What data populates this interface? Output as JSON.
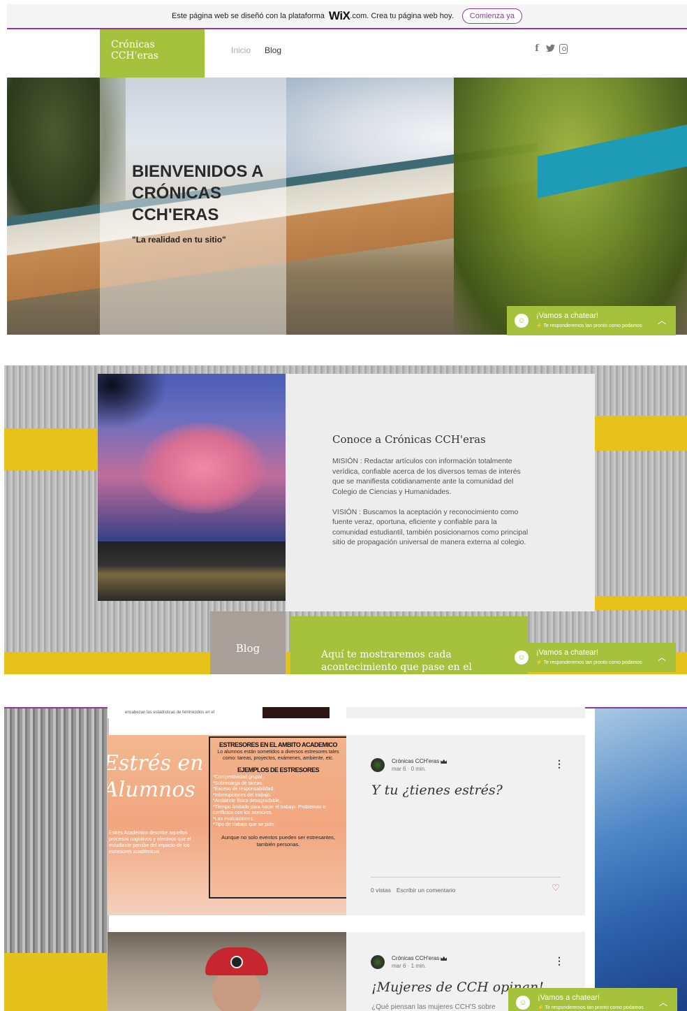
{
  "wix_banner": {
    "text_prefix": "Este página web se diseñó con la plataforma",
    "brand": "WiX",
    "text_suffix": ".com. Crea tu página web hoy.",
    "cta_label": "Comienza ya"
  },
  "header": {
    "logo": "Crónicas CCH'eras",
    "nav": [
      "Inicio",
      "Blog"
    ],
    "social_icons": [
      "facebook-icon",
      "twitter-icon",
      "instagram-icon"
    ]
  },
  "hero": {
    "title": "BIENVENIDOS A CRÓNICAS CCH'ERAS",
    "subtitle": "\"La realidad en tu sitio\""
  },
  "chat": {
    "title": "¡Vamos a chatear!",
    "subtitle": "Te responderemos tan pronto como podamos"
  },
  "about": {
    "title": "Conoce a Crónicas CCH'eras",
    "mission": "MISIÓN : Redactar artículos con información totalmente verídica, confiable acerca de los diversos temas de interés que se manifiesta cotidianamente ante la comunidad del Colegio de Ciencias y Humanidades.",
    "vision": "VISIÓN : Buscamos la aceptación y reconocimiento como fuente veraz, oportuna, eficiente y confiable para la comunidad estudiantil, también posicionarnos como principal sitio de propagación universal de manera externa al colegio."
  },
  "blog_section": {
    "label": "Blog",
    "intro": "Aquí te mostraremos cada acontecimiento que pase en el"
  },
  "top_card": {
    "image_text": "encabezan las estadísticas de feminicidios en el"
  },
  "posts": [
    {
      "author": "Crónicas CCH'eras",
      "date": "mar 6",
      "read_time": "0 min.",
      "title": "Y tu ¿tienes estrés?",
      "views": "0 vistas",
      "comment": "Escribir un comentario",
      "image": {
        "script_line1": "Estrés en",
        "script_line2": "Alumnos",
        "left_text": "Estrés Académico describe aquellos procesos cognitivos y afectivos que el estudiante percibe del impacto de los estresores académicos",
        "poster_heading": "ESTRESORES EN EL AMBITO ACADEMICO",
        "poster_text": "Lo alumnos están sometidos a diversos estresores tales como: tareas, proyectos, exámenes, ambiente, etc.",
        "poster_subheading": "EJEMPLOS DE ESTRESORES",
        "poster_list": [
          "*Competitividad grupal.",
          "*Sobrecarga de tareas.",
          "*Exceso de responsabilidad.",
          "*Interrupciones del trabajo.",
          "*Ambiente físico desagradable.",
          "*Tiempo limitado para hacer el trabajo.  Problemas o conflictos con los asesores.",
          "*Las evaluaciones.",
          "*Tipo de trabajo que se pide."
        ],
        "poster_footer": "Aunque no solo eventos pueden ser estresantes, también personas."
      }
    },
    {
      "author": "Crónicas CCH'eras",
      "date": "mar 6",
      "read_time": "1 min.",
      "title": "¡Mujeres de CCH opinan!",
      "excerpt": "¿Qué piensan las mujeres CCH'S sobre"
    }
  ]
}
